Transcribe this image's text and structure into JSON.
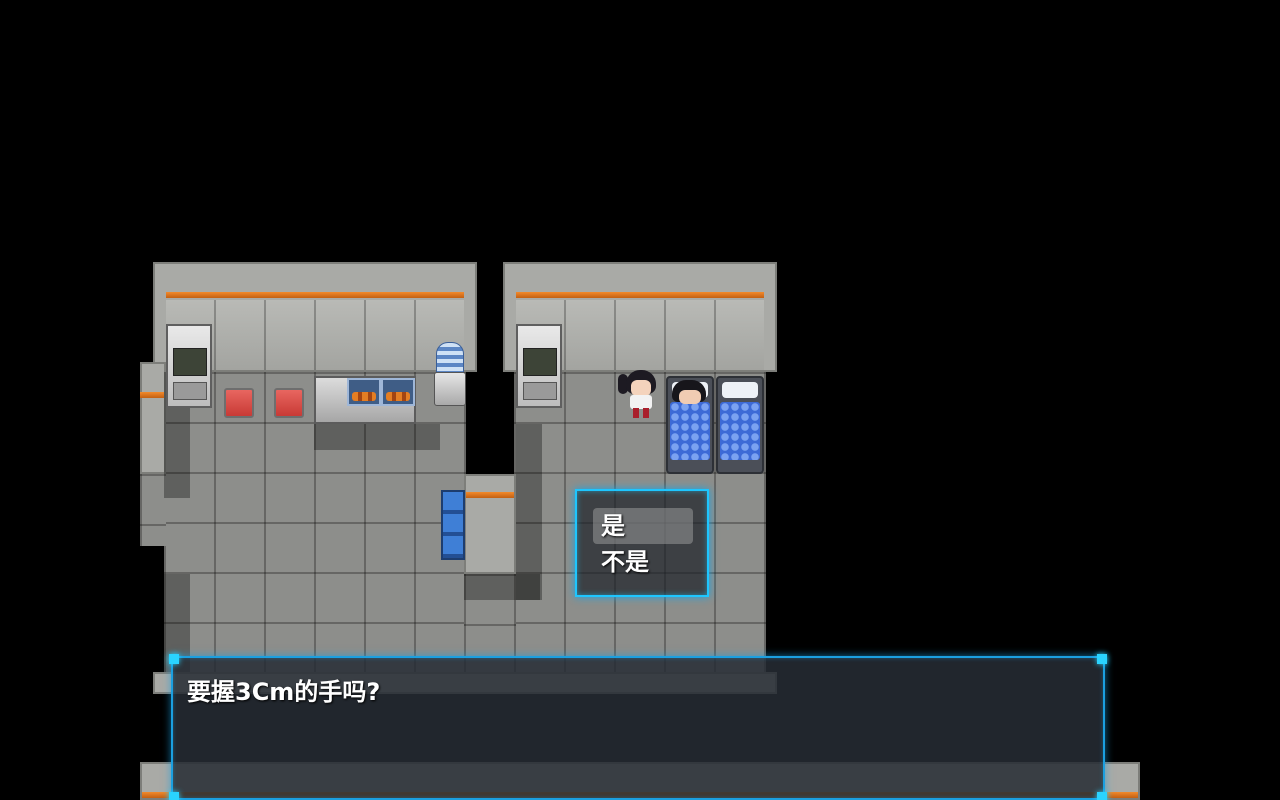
{
  "choice_menu": {
    "items": [
      {
        "label": "是",
        "selected": true
      },
      {
        "label": "不是",
        "selected": false
      }
    ]
  },
  "message": {
    "text": "要握3Cm的手吗?"
  },
  "colors": {
    "window_border": "#1ec6ff",
    "wall_stripe": "#f18a2c",
    "floor": "#8d8e8b",
    "blanket": "#3d6ad6"
  },
  "icons": {
    "selection_highlight": "rounded-rect",
    "window_corners": "glowing-square"
  }
}
